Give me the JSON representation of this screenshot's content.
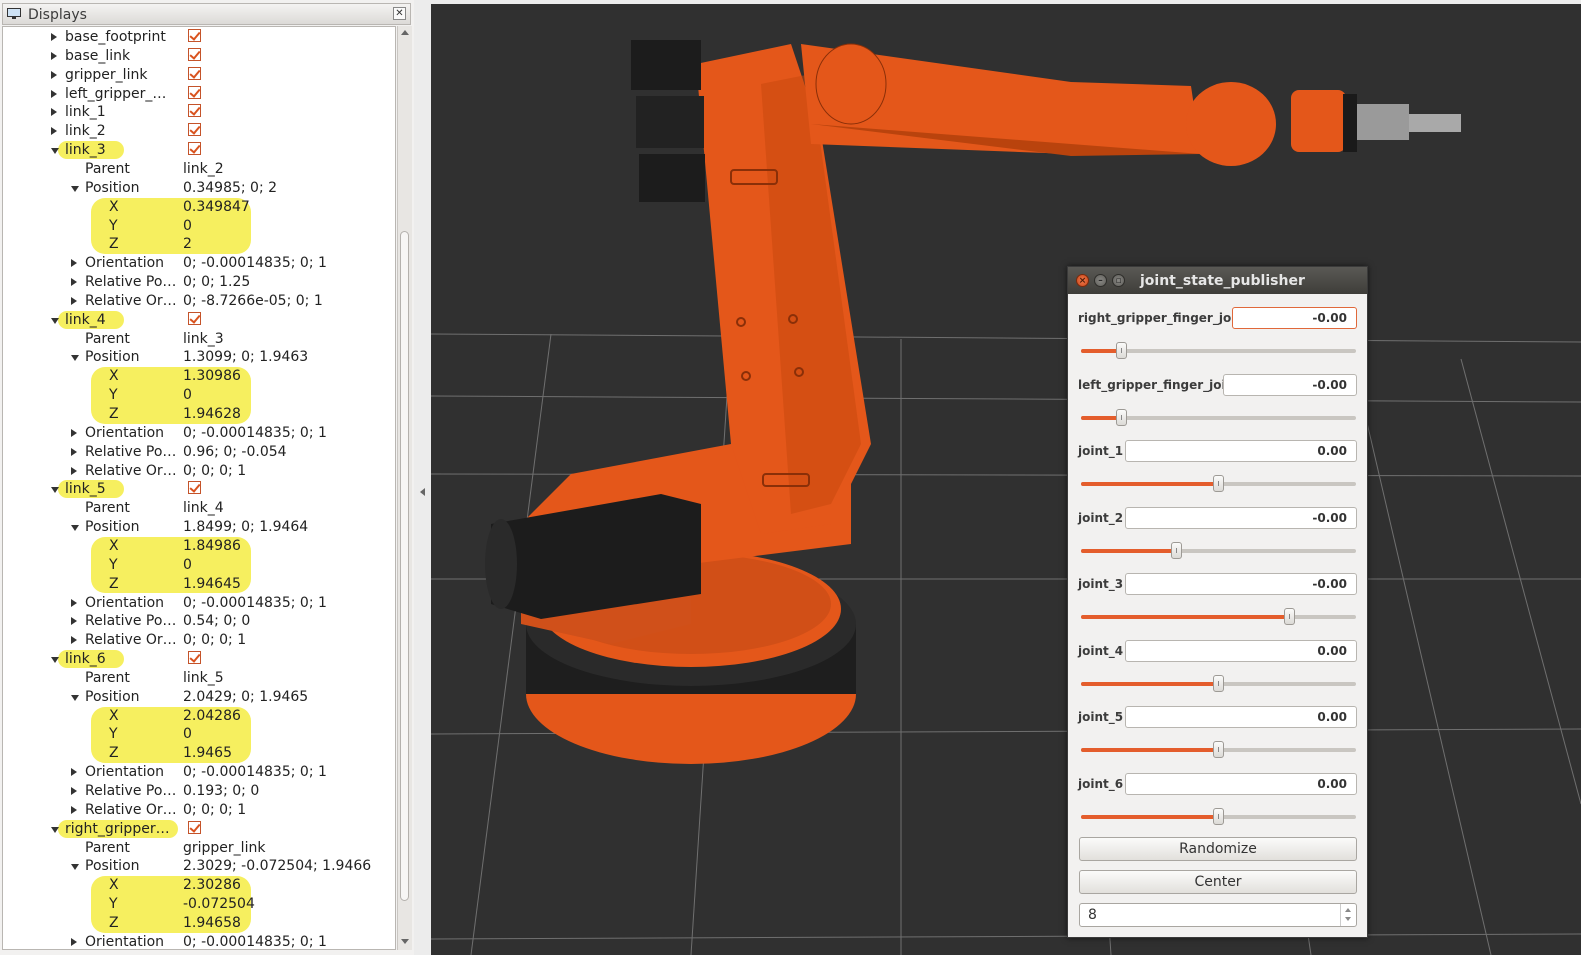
{
  "displays": {
    "title": "Displays",
    "tree": [
      {
        "name": "base_footprint",
        "level": 1,
        "expander": "closed",
        "checked": true
      },
      {
        "name": "base_link",
        "level": 1,
        "expander": "closed",
        "checked": true
      },
      {
        "name": "gripper_link",
        "level": 1,
        "expander": "closed",
        "checked": true
      },
      {
        "name": "left_gripper_…",
        "level": 1,
        "expander": "closed",
        "checked": true
      },
      {
        "name": "link_1",
        "level": 1,
        "expander": "closed",
        "checked": true
      },
      {
        "name": "link_2",
        "level": 1,
        "expander": "closed",
        "checked": true
      },
      {
        "name": "link_3",
        "level": 1,
        "expander": "open",
        "checked": true,
        "highlight": true
      },
      {
        "name": "Parent",
        "level": 2,
        "value": "link_2"
      },
      {
        "name": "Position",
        "level": 2,
        "expander": "open",
        "value": "0.34985; 0; 2"
      },
      {
        "name": "X",
        "level": 3,
        "value": "0.349847"
      },
      {
        "name": "Y",
        "level": 3,
        "value": "0"
      },
      {
        "name": "Z",
        "level": 3,
        "value": "2"
      },
      {
        "name": "Orientation",
        "level": 2,
        "expander": "closed",
        "value": "0; -0.00014835; 0; 1"
      },
      {
        "name": "Relative Po…",
        "level": 2,
        "expander": "closed",
        "value": "0; 0; 1.25"
      },
      {
        "name": "Relative Or…",
        "level": 2,
        "expander": "closed",
        "value": "0; -8.7266e-05; 0; 1"
      },
      {
        "name": "link_4",
        "level": 1,
        "expander": "open",
        "checked": true,
        "highlight": true
      },
      {
        "name": "Parent",
        "level": 2,
        "value": "link_3"
      },
      {
        "name": "Position",
        "level": 2,
        "expander": "open",
        "value": "1.3099; 0; 1.9463"
      },
      {
        "name": "X",
        "level": 3,
        "value": "1.30986"
      },
      {
        "name": "Y",
        "level": 3,
        "value": "0"
      },
      {
        "name": "Z",
        "level": 3,
        "value": "1.94628"
      },
      {
        "name": "Orientation",
        "level": 2,
        "expander": "closed",
        "value": "0; -0.00014835; 0; 1"
      },
      {
        "name": "Relative Po…",
        "level": 2,
        "expander": "closed",
        "value": "0.96; 0; -0.054"
      },
      {
        "name": "Relative Or…",
        "level": 2,
        "expander": "closed",
        "value": "0; 0; 0; 1"
      },
      {
        "name": "link_5",
        "level": 1,
        "expander": "open",
        "checked": true,
        "highlight": true
      },
      {
        "name": "Parent",
        "level": 2,
        "value": "link_4"
      },
      {
        "name": "Position",
        "level": 2,
        "expander": "open",
        "value": "1.8499; 0; 1.9464"
      },
      {
        "name": "X",
        "level": 3,
        "value": "1.84986"
      },
      {
        "name": "Y",
        "level": 3,
        "value": "0"
      },
      {
        "name": "Z",
        "level": 3,
        "value": "1.94645"
      },
      {
        "name": "Orientation",
        "level": 2,
        "expander": "closed",
        "value": "0; -0.00014835; 0; 1"
      },
      {
        "name": "Relative Po…",
        "level": 2,
        "expander": "closed",
        "value": "0.54; 0; 0"
      },
      {
        "name": "Relative Or…",
        "level": 2,
        "expander": "closed",
        "value": "0; 0; 0; 1"
      },
      {
        "name": "link_6",
        "level": 1,
        "expander": "open",
        "checked": true,
        "highlight": true
      },
      {
        "name": "Parent",
        "level": 2,
        "value": "link_5"
      },
      {
        "name": "Position",
        "level": 2,
        "expander": "open",
        "value": "2.0429; 0; 1.9465"
      },
      {
        "name": "X",
        "level": 3,
        "value": "2.04286"
      },
      {
        "name": "Y",
        "level": 3,
        "value": "0"
      },
      {
        "name": "Z",
        "level": 3,
        "value": "1.9465"
      },
      {
        "name": "Orientation",
        "level": 2,
        "expander": "closed",
        "value": "0; -0.00014835; 0; 1"
      },
      {
        "name": "Relative Po…",
        "level": 2,
        "expander": "closed",
        "value": "0.193; 0; 0"
      },
      {
        "name": "Relative Or…",
        "level": 2,
        "expander": "closed",
        "value": "0; 0; 0; 1"
      },
      {
        "name": "right_gripper…",
        "level": 1,
        "expander": "open",
        "checked": true,
        "highlight": true
      },
      {
        "name": "Parent",
        "level": 2,
        "value": "gripper_link"
      },
      {
        "name": "Position",
        "level": 2,
        "expander": "open",
        "value": "2.3029; -0.072504; 1.9466"
      },
      {
        "name": "X",
        "level": 3,
        "value": "2.30286"
      },
      {
        "name": "Y",
        "level": 3,
        "value": "-0.072504"
      },
      {
        "name": "Z",
        "level": 3,
        "value": "1.94658"
      },
      {
        "name": "Orientation",
        "level": 2,
        "expander": "closed",
        "value": "0; -0.00014835; 0; 1"
      }
    ]
  },
  "jsp": {
    "title": "joint_state_publisher",
    "joints": [
      {
        "label": "right_gripper_finger_joint",
        "value": "-0.00",
        "slider": 0.15,
        "focused": true
      },
      {
        "label": "left_gripper_finger_joint",
        "value": "-0.00",
        "slider": 0.15
      },
      {
        "label": "joint_1",
        "value": "0.00",
        "slider": 0.5
      },
      {
        "label": "joint_2",
        "value": "-0.00",
        "slider": 0.35
      },
      {
        "label": "joint_3",
        "value": "-0.00",
        "slider": 0.76
      },
      {
        "label": "joint_4",
        "value": "0.00",
        "slider": 0.5
      },
      {
        "label": "joint_5",
        "value": "0.00",
        "slider": 0.5
      },
      {
        "label": "joint_6",
        "value": "0.00",
        "slider": 0.5
      }
    ],
    "randomize_label": "Randomize",
    "center_label": "Center",
    "spin_value": "8"
  },
  "colors": {
    "robot_orange": "#e4571a",
    "viewport_bg": "#303030",
    "highlight": "#f6ee56",
    "slider_fill": "#e45d2c"
  }
}
